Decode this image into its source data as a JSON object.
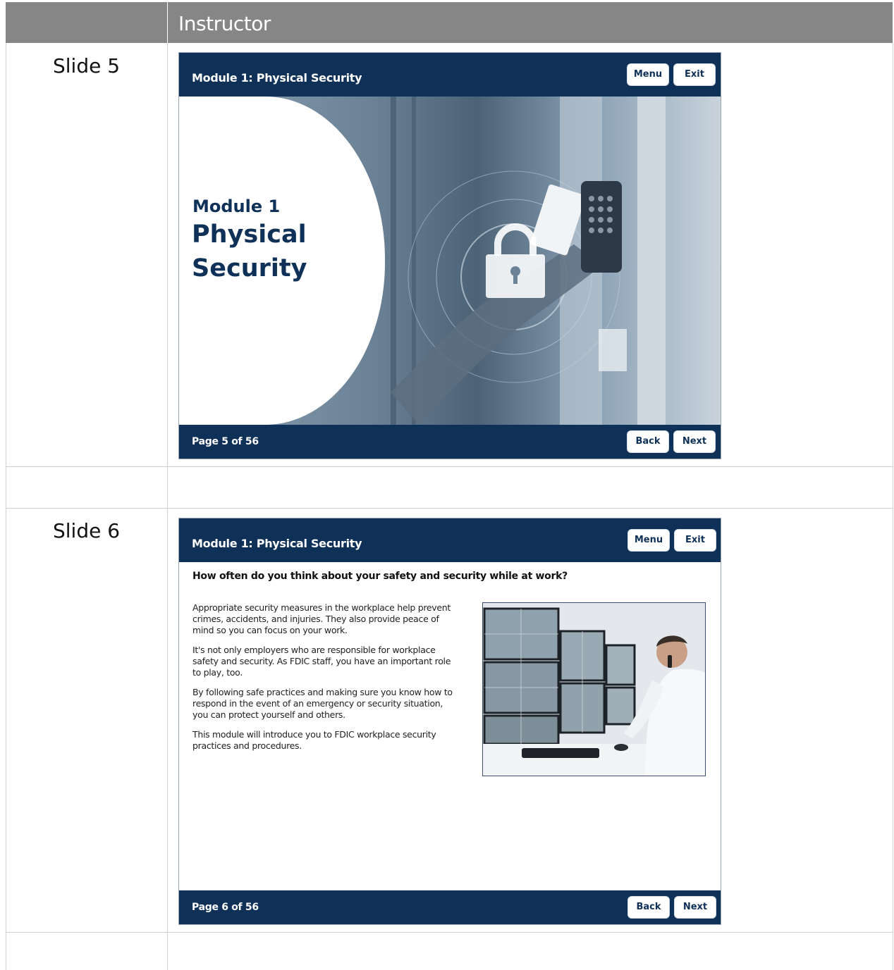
{
  "table": {
    "header": {
      "col1": "",
      "col2": "Instructor"
    },
    "rows": [
      {
        "label": "Slide 5"
      },
      {
        "label": "Slide 6"
      }
    ]
  },
  "slide5": {
    "header_title": "Module 1: Physical Security",
    "menu_label": "Menu",
    "exit_label": "Exit",
    "module_label": "Module 1",
    "heading_line1": "Physical",
    "heading_line2": "Security",
    "page_label": "Page 5 of 56",
    "back_label": "Back",
    "next_label": "Next"
  },
  "slide6": {
    "header_title": "Module 1: Physical Security",
    "menu_label": "Menu",
    "exit_label": "Exit",
    "question": "How often do you think about your safety and security while at work?",
    "paragraphs": [
      "Appropriate security measures in the workplace help prevent crimes, accidents, and injuries. They also provide peace of mind so you can focus on your work.",
      "It's not only employers who are responsible for workplace safety and security. As FDIC staff, you have an important role to play, too.",
      "By following safe practices and making sure you know how to respond in the event of an emergency or security situation, you can protect yourself and others.",
      "This module will introduce you to FDIC workplace security practices and procedures."
    ],
    "page_label": "Page 6 of 56",
    "back_label": "Back",
    "next_label": "Next"
  },
  "colors": {
    "header_gray": "#868686",
    "navy": "#0f3158",
    "grid_line": "#d0d0d0"
  },
  "icons": [
    "padlock-icon",
    "keypad-icon"
  ]
}
